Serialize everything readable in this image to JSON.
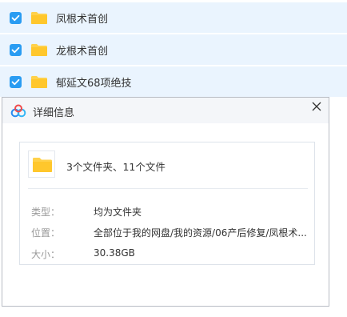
{
  "file_list": {
    "items": [
      {
        "name": "凤根术首创",
        "checked": true
      },
      {
        "name": "龙根术首创",
        "checked": true
      },
      {
        "name": "郁延文68项绝技",
        "checked": true
      }
    ]
  },
  "dialog": {
    "title": "详细信息",
    "summary": "3个文件夹、11个文件",
    "properties": [
      {
        "label": "类型：",
        "value": "均为文件夹"
      },
      {
        "label": "位置：",
        "value": "全部位于我的网盘/我的资源/06产后修复/凤根术..."
      },
      {
        "label": "大小：",
        "value": "30.38GB"
      }
    ]
  },
  "colors": {
    "row_bg": "#eaf4fe",
    "checkbox": "#2a9cf2",
    "folder": "#ffd14a",
    "header_bg": "#f4f6f9"
  }
}
